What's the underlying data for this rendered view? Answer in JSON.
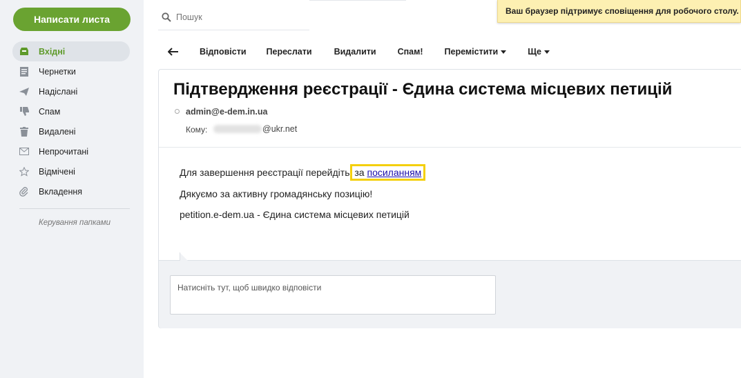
{
  "sidebar": {
    "compose_label": "Написати листа",
    "folders": [
      {
        "label": "Вхідні",
        "icon": "inbox-icon"
      },
      {
        "label": "Чернетки",
        "icon": "drafts-icon"
      },
      {
        "label": "Надіслані",
        "icon": "send-icon"
      },
      {
        "label": "Спам",
        "icon": "thumbs-down-icon"
      },
      {
        "label": "Видалені",
        "icon": "trash-icon"
      },
      {
        "label": "Непрочитані",
        "icon": "envelope-icon"
      },
      {
        "label": "Відмічені",
        "icon": "star-icon"
      },
      {
        "label": "Вкладення",
        "icon": "paperclip-icon"
      }
    ],
    "manage_label": "Керування папками",
    "accent": "#6aa331"
  },
  "search": {
    "placeholder": "Пошук"
  },
  "notification": {
    "text": "Ваш браузер підтримує сповіщення для робочого столу."
  },
  "toolbar": {
    "reply": "Відповісти",
    "forward": "Переслати",
    "delete": "Видалити",
    "spam": "Спам!",
    "move": "Перемістити",
    "more": "Ще"
  },
  "message": {
    "subject": "Підтвердження реєстрації - Єдина система місцевих петицій",
    "sender": "admin@e-dem.in.ua",
    "to_label": "Кому:",
    "to_domain": "@ukr.net",
    "body_line1_prefix": "Для завершення реєстрації перейдіть ",
    "body_line1_link_pre": "за ",
    "body_line1_link": "посиланням",
    "body_line2": "Дякуємо за активну громадянську позицію!",
    "body_line3": "petition.e-dem.ua - Єдина система місцевих петицій",
    "highlight_color": "#f4cf08"
  },
  "reply": {
    "placeholder": "Натисніть тут, щоб швидко відповісти"
  }
}
